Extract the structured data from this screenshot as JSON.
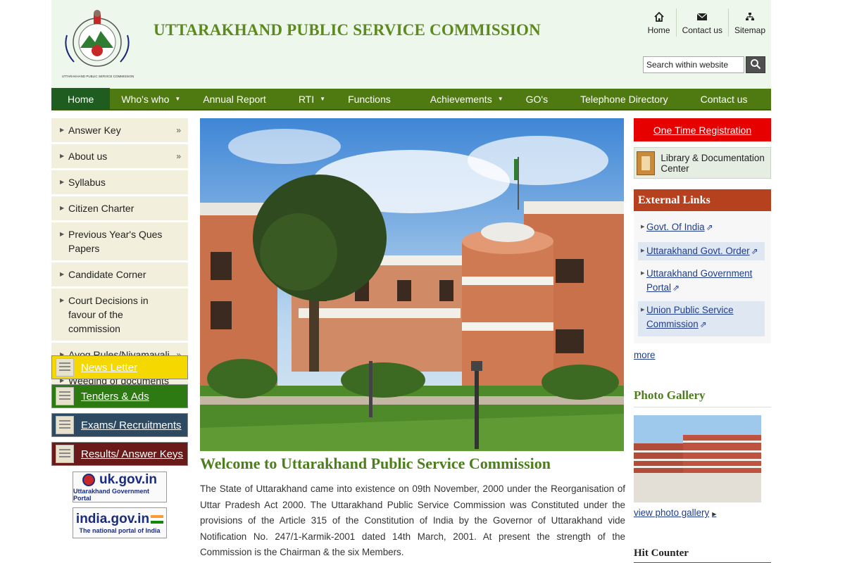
{
  "header": {
    "title": "UTTARAKHAND PUBLIC SERVICE COMMISSION",
    "logo_caption": "UTTARAKHAND PUBLIC SERVICE COMMISSION",
    "top_links": [
      {
        "label": "Home",
        "icon": "home-icon"
      },
      {
        "label": "Contact us",
        "icon": "envelope-icon"
      },
      {
        "label": "Sitemap",
        "icon": "sitemap-icon"
      }
    ],
    "search": {
      "value": "Search within website",
      "icon": "search-icon"
    }
  },
  "nav": {
    "items": [
      {
        "label": "Home",
        "active": true
      },
      {
        "label": "Who's who",
        "dropdown": true
      },
      {
        "label": "Annual Report"
      },
      {
        "label": "RTI",
        "dropdown": true
      },
      {
        "label": "Functions"
      },
      {
        "label": "Achievements",
        "dropdown": true
      },
      {
        "label": "GO's"
      },
      {
        "label": "Telephone Directory"
      },
      {
        "label": "Contact us"
      }
    ]
  },
  "left_menu": {
    "items": [
      {
        "label": "Answer Key",
        "submenu": true
      },
      {
        "label": "About us",
        "submenu": true
      },
      {
        "label": "Syllabus"
      },
      {
        "label": "Citizen Charter"
      },
      {
        "label": "Previous Year's Ques Papers"
      },
      {
        "label": "Candidate Corner"
      },
      {
        "label": "Court Decisions in favour of the commission"
      },
      {
        "label": "Ayog Rules/Niyamavali",
        "submenu": true
      },
      {
        "label": "Weeding of documents"
      }
    ],
    "buttons": {
      "news": "News Letter",
      "tenders": "Tenders & Ads",
      "exams": "Exams/ Recruitments",
      "results": "Results/ Answer Keys"
    },
    "portals": {
      "uk_title": "uk.gov.in",
      "uk_sub": "Uttarakhand Government Portal",
      "india_title": "india.gov.in",
      "india_sub": "The national portal of India"
    }
  },
  "main": {
    "welcome_title": "Welcome to Uttarakhand Public Service Commission",
    "intro": "The State of Uttarakhand came into existence on 09th November, 2000 under the Reorganisation of Uttar Pradesh Act 2000. The Uttarakhand Public Service Commission was Constituted under the provisions of the Article 315 of the Constitution of India by the Governor of Uttarakhand vide Notification No. 247/1-Karmik-2001 dated 14th March, 2001. At present the strength of the Commission is the Chairman & the six Members."
  },
  "right": {
    "otr": "One Time Registration",
    "library": "Library & Documentation Center",
    "external_links_title": "External Links",
    "external_links": [
      "Govt. Of India",
      "Uttarakhand Govt. Order",
      "Uttarakhand Government Portal",
      "Union Public Service Commission"
    ],
    "more": "more",
    "photo_gallery_title": "Photo Gallery",
    "view_gallery": "view photo gallery",
    "hit_counter_title": "Hit Counter"
  },
  "colors": {
    "nav_green": "#4f7a12",
    "header_bg": "#eef7ec",
    "title_green": "#5c8a1f",
    "otr_red": "#e60000",
    "external_links_brown": "#b5411e"
  }
}
